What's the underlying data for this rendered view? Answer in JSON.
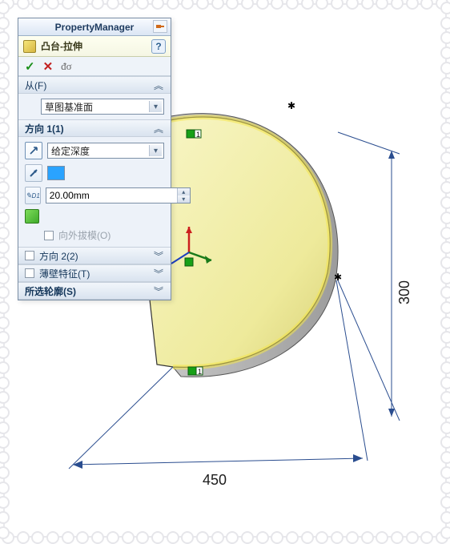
{
  "pm": {
    "title": "PropertyManager",
    "feature_name": "凸台-拉伸",
    "help_glyph": "?",
    "ok_glyph": "✓",
    "cancel_glyph": "✕",
    "preview_glyph": "ᵭσ"
  },
  "from": {
    "label": "从(F)",
    "value": "草图基准面"
  },
  "dir1": {
    "label": "方向 1(1)",
    "end_condition": "给定深度",
    "depth": "20.00mm",
    "draft_label": "向外拔模(O)"
  },
  "dir2": {
    "label": "方向 2(2)"
  },
  "thin": {
    "label": "薄壁特征(T)"
  },
  "contour": {
    "label": "所选轮廓(S)"
  },
  "dims": {
    "width": "450",
    "height": "300"
  },
  "markers": {
    "p1": "1",
    "p2": "1"
  }
}
